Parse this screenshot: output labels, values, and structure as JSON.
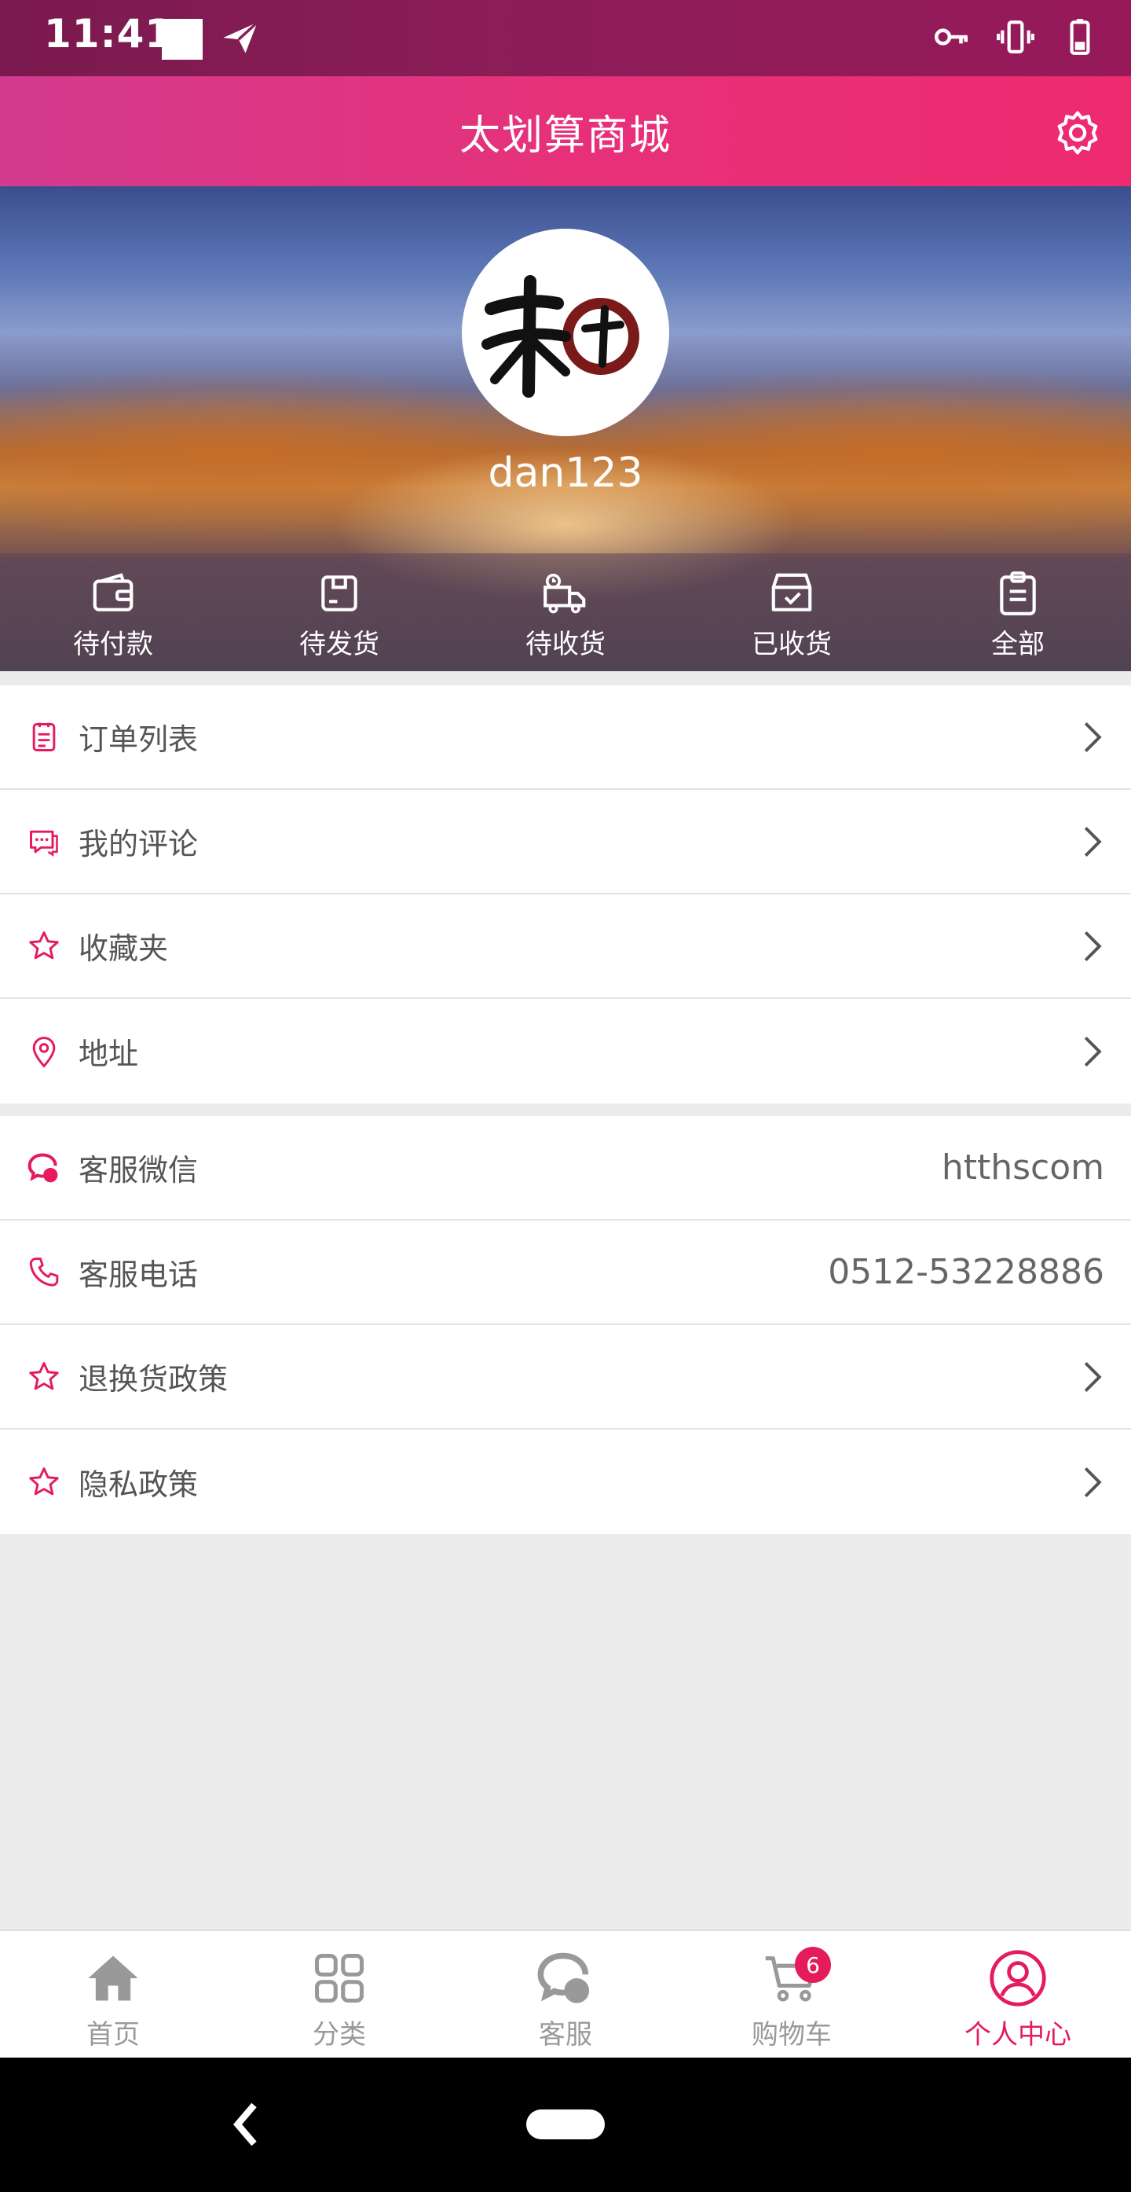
{
  "status_bar": {
    "time": "11:41"
  },
  "header": {
    "title": "太划算商城"
  },
  "profile": {
    "username": "dan123"
  },
  "orders": [
    {
      "label": "待付款",
      "icon": "wallet-icon"
    },
    {
      "label": "待发货",
      "icon": "package-icon"
    },
    {
      "label": "待收货",
      "icon": "truck-icon"
    },
    {
      "label": "已收货",
      "icon": "inbox-check-icon"
    },
    {
      "label": "全部",
      "icon": "clipboard-icon"
    }
  ],
  "menu_group_1": [
    {
      "label": "订单列表",
      "icon": "order-list-icon"
    },
    {
      "label": "我的评论",
      "icon": "comment-icon"
    },
    {
      "label": "收藏夹",
      "icon": "star-icon"
    },
    {
      "label": "地址",
      "icon": "location-icon"
    }
  ],
  "menu_group_2": [
    {
      "label": "客服微信",
      "value": "htthscom",
      "icon": "wechat-chat-icon"
    },
    {
      "label": "客服电话",
      "value": "0512-53228886",
      "icon": "phone-icon"
    },
    {
      "label": "退换货政策",
      "icon": "star-icon"
    },
    {
      "label": "隐私政策",
      "icon": "star-icon"
    }
  ],
  "bottom_nav": [
    {
      "label": "首页",
      "icon": "home-icon"
    },
    {
      "label": "分类",
      "icon": "grid-icon"
    },
    {
      "label": "客服",
      "icon": "chat-icon"
    },
    {
      "label": "购物车",
      "icon": "cart-icon",
      "badge": "6"
    },
    {
      "label": "个人中心",
      "icon": "user-icon",
      "active": true
    }
  ],
  "colors": {
    "accent": "#e51b5c",
    "header_start": "#d33b8e",
    "header_end": "#ee2a6f",
    "status_bar": "#8a1d57"
  }
}
